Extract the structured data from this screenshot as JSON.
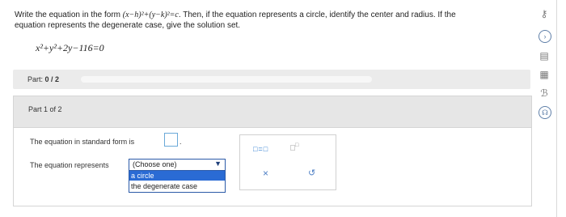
{
  "question": {
    "text_line1_a": "Write the equation in the form ",
    "form_expression": "(x−h)²+(y−k)²=c",
    "text_line1_b": ". Then, if the equation represents a circle, identify the center and radius. If the",
    "text_line2": "equation represents the degenerate case, give the solution set.",
    "equation": "x²+y²+2y−116=0"
  },
  "part_bar": {
    "label_prefix": "Part: ",
    "label_value": "0 / 2",
    "progress": 0
  },
  "part1": {
    "title": "Part 1 of 2",
    "standard_form_prompt": "The equation in standard form is",
    "period": ".",
    "represents_prompt": "The equation represents",
    "select": {
      "selected": "(Choose one)",
      "arrow": "▼",
      "options": [
        "a circle",
        "the degenerate case"
      ],
      "highlighted_index": 0
    }
  },
  "tools": {
    "fraction_label": "□=□",
    "superscript_label": "□",
    "superscript_small": "□",
    "clear_icon": "×",
    "undo_icon": "↺"
  },
  "sidebar": {
    "icons": [
      "key-icon",
      "chevron-right-icon",
      "calculator-icon",
      "table-icon",
      "language-icon",
      "headset-icon"
    ],
    "glyphs": [
      "⚷",
      "›",
      "▤",
      "▦",
      "ℬ",
      "☊"
    ]
  },
  "colors": {
    "accent_blue": "#2a6bd4",
    "tool_blue": "#2a7bd1",
    "part_bar_gray": "#ebebeb"
  }
}
